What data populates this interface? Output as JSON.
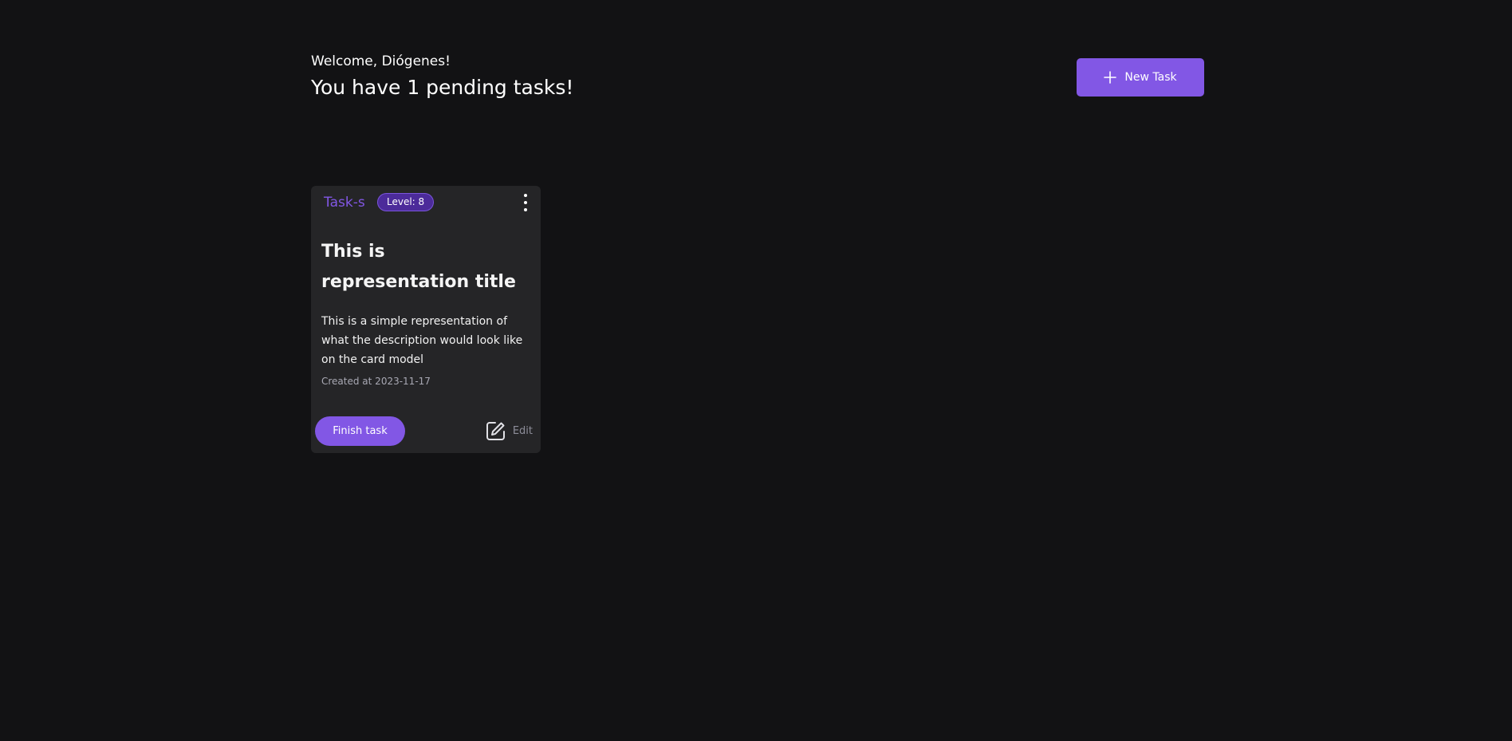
{
  "header": {
    "greeting": "Welcome, Diógenes!",
    "pending_text": "You have 1 pending tasks!",
    "new_task_label": "New Task",
    "new_task_icon": "plus-icon"
  },
  "tasks": [
    {
      "tag": "Task-s",
      "level": "Level: 8",
      "title": "This is representation title",
      "description": "This is a simple representation of what the description would look like on the card model",
      "created": "Created at 2023-11-17",
      "finish_label": "Finish task",
      "edit_label": "Edit",
      "menu_icon": "more-vertical-icon",
      "edit_icon": "edit-icon"
    }
  ],
  "colors": {
    "background": "#121214",
    "card": "#252527",
    "accent": "#8257e5",
    "badge": "#4c2b9a",
    "muted": "#a8a8b3"
  }
}
